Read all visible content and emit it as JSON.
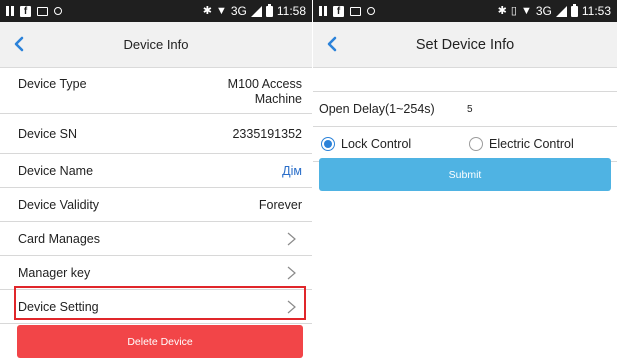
{
  "left": {
    "status": {
      "time": "11:58",
      "network": "3G"
    },
    "title": "Device Info",
    "rows": [
      {
        "label": "Device Type",
        "value_line1": "M100 Access",
        "value_line2": "Machine"
      },
      {
        "label": "Device SN",
        "value": "2335191352"
      },
      {
        "label": "Device Name",
        "value": "Дім"
      },
      {
        "label": "Device Validity",
        "value": "Forever"
      },
      {
        "label": "Card Manages"
      },
      {
        "label": "Manager key"
      },
      {
        "label": "Device Setting"
      }
    ],
    "delete_label": "Delete Device",
    "colors": {
      "delete": "#f24548",
      "highlight": "#e0262a",
      "link": "#2a6ec9"
    }
  },
  "right": {
    "status": {
      "time": "11:53",
      "network": "3G"
    },
    "title": "Set Device Info",
    "delay_label": "Open Delay(1~254s)",
    "delay_value": "5",
    "radio_options": [
      {
        "label": "Lock Control",
        "checked": true
      },
      {
        "label": "Electric Control",
        "checked": false
      }
    ],
    "submit_label": "Submit",
    "colors": {
      "submit": "#4fb3e3",
      "accent": "#2b82d9"
    }
  },
  "icons": [
    "pause-icon",
    "facebook-icon",
    "image-icon",
    "circle-icon",
    "bluetooth-icon",
    "wifi-icon",
    "signal-icon",
    "battery-icon",
    "back-arrow-icon",
    "chevron-right-icon",
    "vibrate-icon"
  ]
}
